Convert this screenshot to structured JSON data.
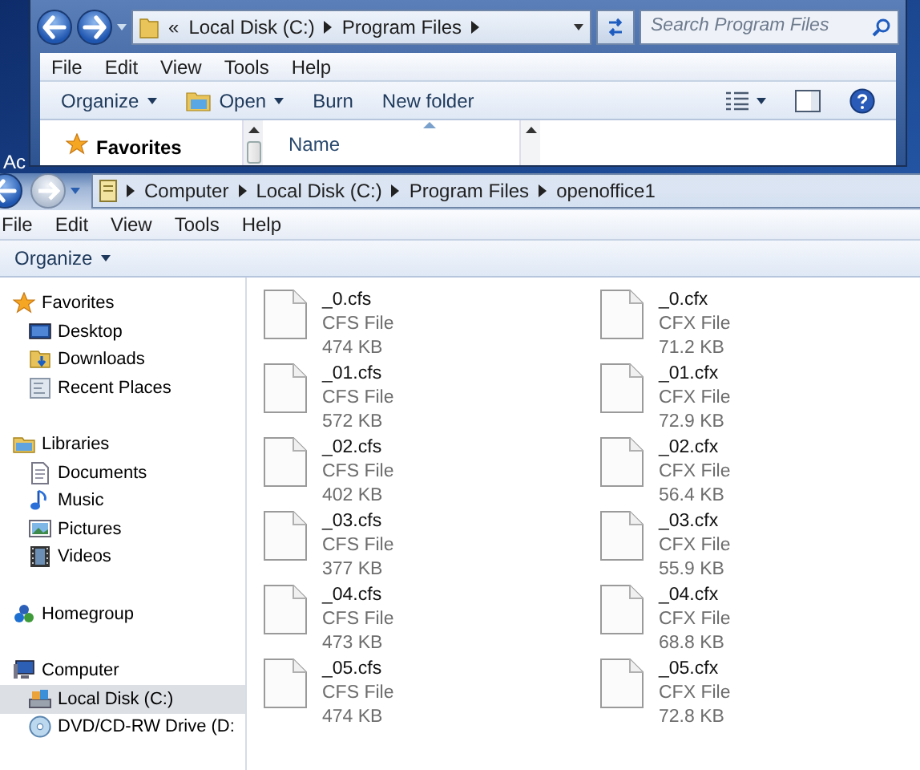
{
  "desktop": {
    "icon_label": "Ac"
  },
  "back_window": {
    "overflow": "«",
    "breadcrumb": [
      "Local Disk (C:)",
      "Program Files"
    ],
    "search": {
      "placeholder": "Search Program Files"
    },
    "menu": [
      "File",
      "Edit",
      "View",
      "Tools",
      "Help"
    ],
    "toolbar": [
      {
        "label": "Organize",
        "kind": "dropdown"
      },
      {
        "label": "Open",
        "kind": "open"
      },
      {
        "label": "Burn",
        "kind": "plain"
      },
      {
        "label": "New folder",
        "kind": "plain"
      }
    ],
    "nav_items": [
      {
        "label": "Favorites",
        "kind": "star"
      }
    ],
    "column": "Name"
  },
  "front_window": {
    "breadcrumb": [
      "Computer",
      "Local Disk (C:)",
      "Program Files",
      "openoffice1"
    ],
    "menu": [
      "File",
      "Edit",
      "View",
      "Tools",
      "Help"
    ],
    "toolbar": [
      {
        "label": "Organize",
        "kind": "dropdown"
      }
    ],
    "nav": [
      {
        "label": "Favorites",
        "kind": "star",
        "selected": false,
        "children": [
          {
            "label": "Desktop",
            "kind": "desktop",
            "selected": false
          },
          {
            "label": "Downloads",
            "kind": "downloads",
            "selected": false
          },
          {
            "label": "Recent Places",
            "kind": "recent",
            "selected": false
          }
        ]
      },
      {
        "label": "Libraries",
        "kind": "library",
        "selected": false,
        "children": [
          {
            "label": "Documents",
            "kind": "document",
            "selected": false
          },
          {
            "label": "Music",
            "kind": "music",
            "selected": false
          },
          {
            "label": "Pictures",
            "kind": "pictures",
            "selected": false
          },
          {
            "label": "Videos",
            "kind": "videos",
            "selected": false
          }
        ]
      },
      {
        "label": "Homegroup",
        "kind": "homegroup",
        "selected": false
      },
      {
        "label": "Computer",
        "kind": "computer",
        "selected": false,
        "children": [
          {
            "label": "Local Disk (C:)",
            "kind": "disk",
            "selected": true
          },
          {
            "label": "DVD/CD-RW Drive (D:",
            "kind": "dvd",
            "selected": false
          }
        ]
      }
    ],
    "files": [
      {
        "name": "_0.cfs",
        "type": "CFS File",
        "size": "474 KB"
      },
      {
        "name": "_0.cfx",
        "type": "CFX File",
        "size": "71.2 KB"
      },
      {
        "name": "_01.cfs",
        "type": "CFS File",
        "size": "572 KB"
      },
      {
        "name": "_01.cfx",
        "type": "CFX File",
        "size": "72.9 KB"
      },
      {
        "name": "_02.cfs",
        "type": "CFS File",
        "size": "402 KB"
      },
      {
        "name": "_02.cfx",
        "type": "CFX File",
        "size": "56.4 KB"
      },
      {
        "name": "_03.cfs",
        "type": "CFS File",
        "size": "377 KB"
      },
      {
        "name": "_03.cfx",
        "type": "CFX File",
        "size": "55.9 KB"
      },
      {
        "name": "_04.cfs",
        "type": "CFS File",
        "size": "473 KB"
      },
      {
        "name": "_04.cfx",
        "type": "CFX File",
        "size": "68.8 KB"
      },
      {
        "name": "_05.cfs",
        "type": "CFS File",
        "size": "474 KB"
      },
      {
        "name": "_05.cfx",
        "type": "CFX File",
        "size": "72.8 KB"
      }
    ]
  }
}
